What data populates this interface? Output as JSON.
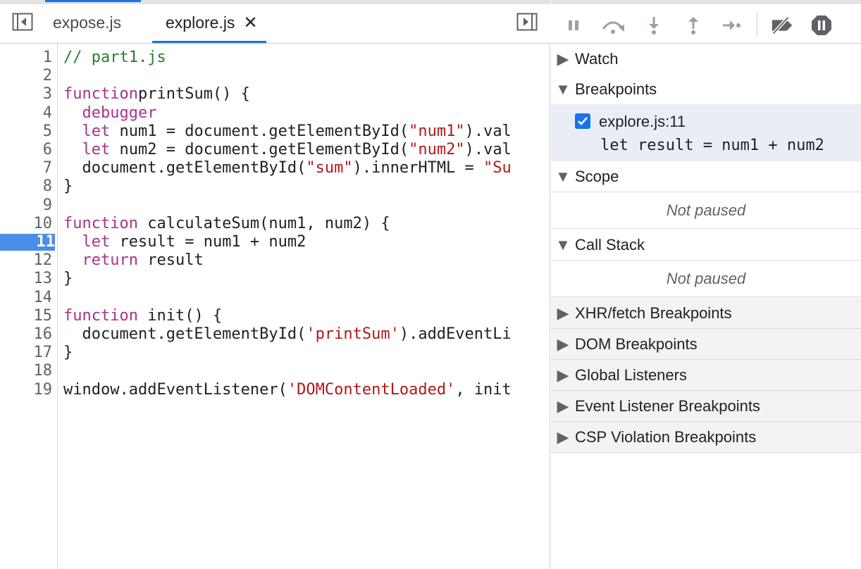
{
  "editor": {
    "tabs": [
      {
        "label": "expose.js",
        "active": false
      },
      {
        "label": "explore.js",
        "active": true,
        "close": "✕"
      }
    ],
    "breakpoint_line": "11",
    "lines": [
      {
        "n": "1",
        "segs": [
          [
            "cm",
            "// part1.js"
          ]
        ]
      },
      {
        "n": "2",
        "segs": []
      },
      {
        "n": "3",
        "segs": [
          [
            "kw",
            "function"
          ],
          [
            "",
            "printSum() {"
          ]
        ]
      },
      {
        "n": "4",
        "segs": [
          [
            "",
            "  "
          ],
          [
            "kw",
            "debugger"
          ]
        ]
      },
      {
        "n": "5",
        "segs": [
          [
            "",
            "  "
          ],
          [
            "kw",
            "let"
          ],
          [
            "",
            " num1 = document.getElementById("
          ],
          [
            "str",
            "\"num1\""
          ],
          [
            "",
            ").val"
          ]
        ]
      },
      {
        "n": "6",
        "segs": [
          [
            "",
            "  "
          ],
          [
            "kw",
            "let"
          ],
          [
            "",
            " num2 = document.getElementById("
          ],
          [
            "str",
            "\"num2\""
          ],
          [
            "",
            ").val"
          ]
        ]
      },
      {
        "n": "7",
        "segs": [
          [
            "",
            "  document.getElementById("
          ],
          [
            "str",
            "\"sum\""
          ],
          [
            "",
            ").innerHTML = "
          ],
          [
            "str",
            "\"Su"
          ]
        ]
      },
      {
        "n": "8",
        "segs": [
          [
            "",
            "}"
          ]
        ]
      },
      {
        "n": "9",
        "segs": []
      },
      {
        "n": "10",
        "segs": [
          [
            "kw",
            "function"
          ],
          [
            "",
            " calculateSum(num1, num2) {"
          ]
        ]
      },
      {
        "n": "11",
        "segs": [
          [
            "",
            "  "
          ],
          [
            "kw",
            "let"
          ],
          [
            "",
            " result = num1 + num2"
          ]
        ]
      },
      {
        "n": "12",
        "segs": [
          [
            "",
            "  "
          ],
          [
            "kw",
            "return"
          ],
          [
            "",
            " result"
          ]
        ]
      },
      {
        "n": "13",
        "segs": [
          [
            "",
            "}"
          ]
        ]
      },
      {
        "n": "14",
        "segs": []
      },
      {
        "n": "15",
        "segs": [
          [
            "kw",
            "function"
          ],
          [
            "",
            " init() {"
          ]
        ]
      },
      {
        "n": "16",
        "segs": [
          [
            "",
            "  document.getElementById("
          ],
          [
            "str",
            "'printSum'"
          ],
          [
            "",
            ").addEventLi"
          ]
        ]
      },
      {
        "n": "17",
        "segs": [
          [
            "",
            "}"
          ]
        ]
      },
      {
        "n": "18",
        "segs": []
      },
      {
        "n": "19",
        "segs": [
          [
            "",
            "window.addEventListener("
          ],
          [
            "str",
            "'DOMContentLoaded'"
          ],
          [
            "",
            ", init"
          ]
        ]
      }
    ]
  },
  "debugger": {
    "sections": {
      "watch": "Watch",
      "breakpoints": "Breakpoints",
      "scope": "Scope",
      "call_stack": "Call Stack",
      "xhr": "XHR/fetch Breakpoints",
      "dom": "DOM Breakpoints",
      "global": "Global Listeners",
      "event": "Event Listener Breakpoints",
      "csp": "CSP Violation Breakpoints"
    },
    "breakpoint": {
      "location": "explore.js:11",
      "code": "let result = num1 + num2",
      "checked": true
    },
    "scope_empty": "Not paused",
    "callstack_empty": "Not paused"
  }
}
